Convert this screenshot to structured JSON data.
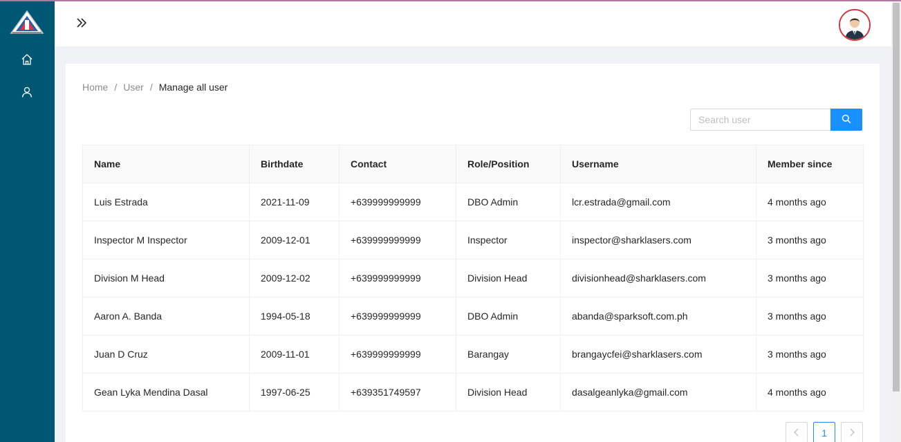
{
  "header": {
    "avatar_alt": "user avatar"
  },
  "breadcrumb": {
    "items": [
      "Home",
      "User"
    ],
    "current": "Manage all user"
  },
  "search": {
    "placeholder": "Search user",
    "value": ""
  },
  "table": {
    "columns": [
      "Name",
      "Birthdate",
      "Contact",
      "Role/Position",
      "Username",
      "Member since"
    ],
    "rows": [
      [
        "Luis Estrada",
        "2021-11-09",
        "+639999999999",
        "DBO Admin",
        "lcr.estrada@gmail.com",
        "4 months ago"
      ],
      [
        "Inspector M Inspector",
        "2009-12-01",
        "+639999999999",
        "Inspector",
        "inspector@sharklasers.com",
        "3 months ago"
      ],
      [
        "Division M Head",
        "2009-12-02",
        "+639999999999",
        "Division Head",
        "divisionhead@sharklasers.com",
        "3 months ago"
      ],
      [
        "Aaron A. Banda",
        "1994-05-18",
        "+639999999999",
        "DBO Admin",
        "abanda@sparksoft.com.ph",
        "3 months ago"
      ],
      [
        "Juan D Cruz",
        "2009-11-01",
        "+639999999999",
        "Barangay",
        "brangaycfei@sharklasers.com",
        "3 months ago"
      ],
      [
        "Gean Lyka Mendina Dasal",
        "1997-06-25",
        "+639351749597",
        "Division Head",
        "dasalgeanlyka@gmail.com",
        "4 months ago"
      ]
    ]
  },
  "pagination": {
    "current_page": "1"
  },
  "colors": {
    "sidebar": "#005773",
    "accent": "#1890ff",
    "avatar_border": "#d9363e"
  },
  "icons": {
    "logo": "agency-logo-icon",
    "nav_home": "home-icon",
    "nav_user": "user-icon",
    "collapse": "double-chevron-right-icon",
    "search": "search-icon",
    "prev": "chevron-left-icon",
    "next": "chevron-right-icon"
  }
}
